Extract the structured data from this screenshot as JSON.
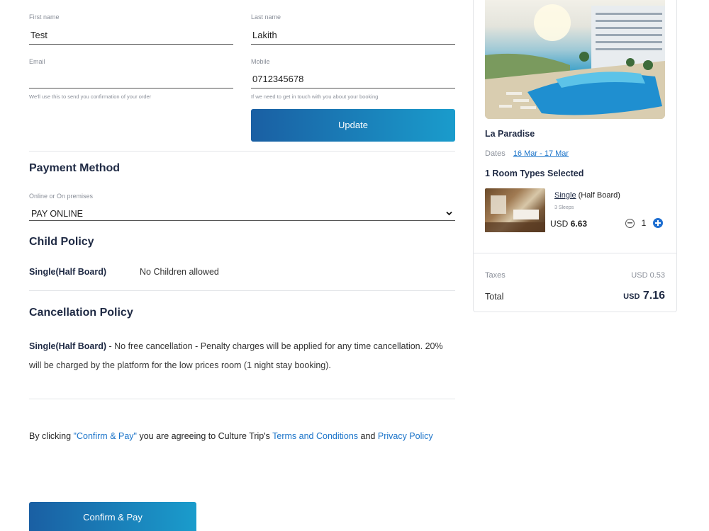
{
  "contact": {
    "first_name_label": "First name",
    "first_name_value": "Test",
    "last_name_label": "Last name",
    "last_name_value": "Lakith",
    "email_label": "Email",
    "email_value": "",
    "email_hint": "We'll use this to send you confirmation of your order",
    "mobile_label": "Mobile",
    "mobile_value": "0712345678",
    "mobile_hint": "If we need to get in touch with you about your booking",
    "update_label": "Update"
  },
  "payment": {
    "title": "Payment Method",
    "select_label": "Online or On premises",
    "selected_option": "PAY ONLINE"
  },
  "child_policy": {
    "title": "Child Policy",
    "room": "Single(Half Board)",
    "policy": "No Children allowed"
  },
  "cancellation": {
    "title": "Cancellation Policy",
    "room": "Single(Half Board)",
    "text_line1": " - No free cancellation - Penalty charges will be applied for any time cancellation. 20%",
    "text_line2": "will be charged by the platform for the low prices room (1 night stay booking)."
  },
  "agreement": {
    "prefix": "By clicking ",
    "confirm_quote": "\"Confirm & Pay\"",
    "middle": " you are agreeing to Culture Trip's ",
    "terms": "Terms and Conditions",
    "and": " and ",
    "privacy": "Privacy Policy"
  },
  "confirm_label": "Confirm & Pay",
  "summary": {
    "hotel_name": "La Paradise",
    "dates_label": "Dates",
    "dates_value": "16 Mar - 17 Mar",
    "room_types_selected": "1 Room Types Selected",
    "room": {
      "name": "Single",
      "board": " (Half Board)",
      "sleeps": "3 Sleeps",
      "currency": "USD",
      "price": "6.63",
      "quantity": "1"
    },
    "taxes_label": "Taxes",
    "taxes_value": "USD 0.53",
    "total_label": "Total",
    "total_currency": "USD",
    "total_value": "7.16"
  },
  "colors": {
    "accent_gradient_start": "#1a5fa3",
    "accent_gradient_end": "#1a9ccc",
    "link": "#1a73c9",
    "plus_button": "#1f6fd1"
  }
}
